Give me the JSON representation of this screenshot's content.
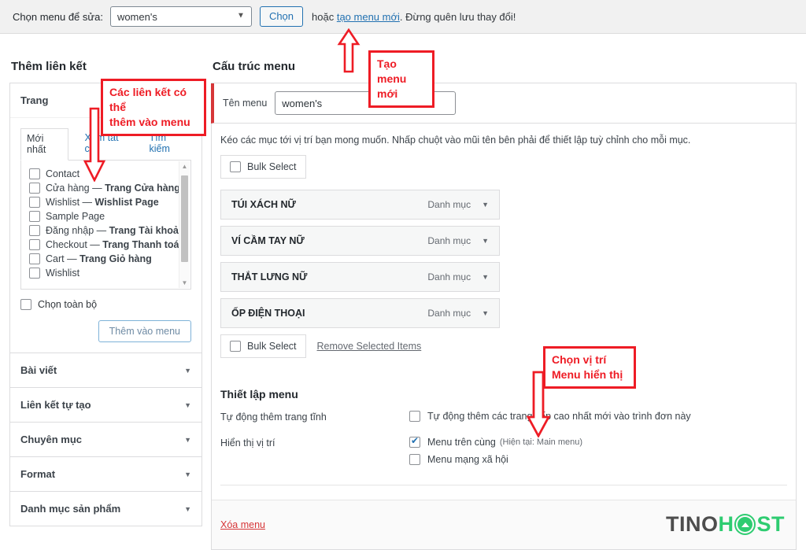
{
  "topbar": {
    "label": "Chọn menu để sửa:",
    "selected_menu": "women's",
    "options": [
      "women's"
    ],
    "select_button": "Chọn",
    "tail_prefix": "hoặc ",
    "tail_link": "tạo menu mới",
    "tail_suffix": ". Đừng quên lưu thay đổi!"
  },
  "columns": {
    "left_title": "Thêm liên kết",
    "right_title": "Cấu trúc menu"
  },
  "left": {
    "pages_panel": {
      "heading": "Trang",
      "tabs": [
        {
          "label": "Mới nhất",
          "active": true
        },
        {
          "label": "Xem tất cả",
          "active": false
        },
        {
          "label": "Tìm kiếm",
          "active": false
        }
      ],
      "items": [
        {
          "label": "Contact",
          "bold": "",
          "checked": false
        },
        {
          "label": "Cửa hàng — ",
          "bold": "Trang Cửa hàng",
          "checked": false
        },
        {
          "label": "Wishlist — ",
          "bold": "Wishlist Page",
          "checked": false
        },
        {
          "label": "Sample Page",
          "bold": "",
          "checked": false
        },
        {
          "label": "Đăng nhập — ",
          "bold": "Trang Tài khoản",
          "checked": false
        },
        {
          "label": "Checkout — ",
          "bold": "Trang Thanh toán",
          "checked": false
        },
        {
          "label": "Cart — ",
          "bold": "Trang Giỏ hàng",
          "checked": false
        },
        {
          "label": "Wishlist",
          "bold": "",
          "checked": false
        }
      ],
      "select_all": "Chọn toàn bộ",
      "add_button": "Thêm vào menu"
    },
    "accordions": [
      {
        "label": "Bài viết"
      },
      {
        "label": "Liên kết tự tạo"
      },
      {
        "label": "Chuyên mục"
      },
      {
        "label": "Format"
      },
      {
        "label": "Danh mục sản phẩm"
      }
    ]
  },
  "right": {
    "menu_name_label": "Tên menu",
    "menu_name_value": "women's",
    "hint": "Kéo các mục tới vị trí bạn mong muốn. Nhấp chuột vào mũi tên bên phải để thiết lập tuỳ chỉnh cho mỗi mục.",
    "bulk_select_top": "Bulk Select",
    "bulk_select_bottom": "Bulk Select",
    "remove_selected": "Remove Selected Items",
    "menu_items": [
      {
        "name": "TÚI XÁCH NỮ",
        "type": "Danh mục"
      },
      {
        "name": "VÍ CẦM TAY NỮ",
        "type": "Danh mục"
      },
      {
        "name": "THẮT LƯNG NỮ",
        "type": "Danh mục"
      },
      {
        "name": "ỐP ĐIỆN THOẠI",
        "type": "Danh mục"
      }
    ],
    "settings": {
      "title": "Thiết lập menu",
      "auto_add_label": "Tự động thêm trang tĩnh",
      "auto_add_option": "Tự động thêm các trang cấp cao nhất mới vào trình đơn này",
      "auto_add_checked": false,
      "display_label": "Hiển thị vị trí",
      "locations": [
        {
          "label": "Menu trên cùng",
          "note": "(Hiện tại: Main menu)",
          "checked": true
        },
        {
          "label": "Menu mạng xã hội",
          "note": "",
          "checked": false
        }
      ]
    },
    "delete_menu": "Xóa menu",
    "logo": {
      "part1": "TINO",
      "part2": "H",
      "part3": "ST"
    }
  },
  "annotations": [
    {
      "id": "links",
      "text": "Các liên kết có thể\nthêm vào menu"
    },
    {
      "id": "create",
      "text": "Tạo menu\nmới"
    },
    {
      "id": "position",
      "text": "Chọn vị trí\nMenu hiển thị"
    }
  ],
  "colors": {
    "annotation_red": "#ee1c25",
    "wp_blue": "#2271b1",
    "delete_red": "#d63638",
    "brand_green": "#2ecc71",
    "brand_gray": "#4d4d4d"
  }
}
